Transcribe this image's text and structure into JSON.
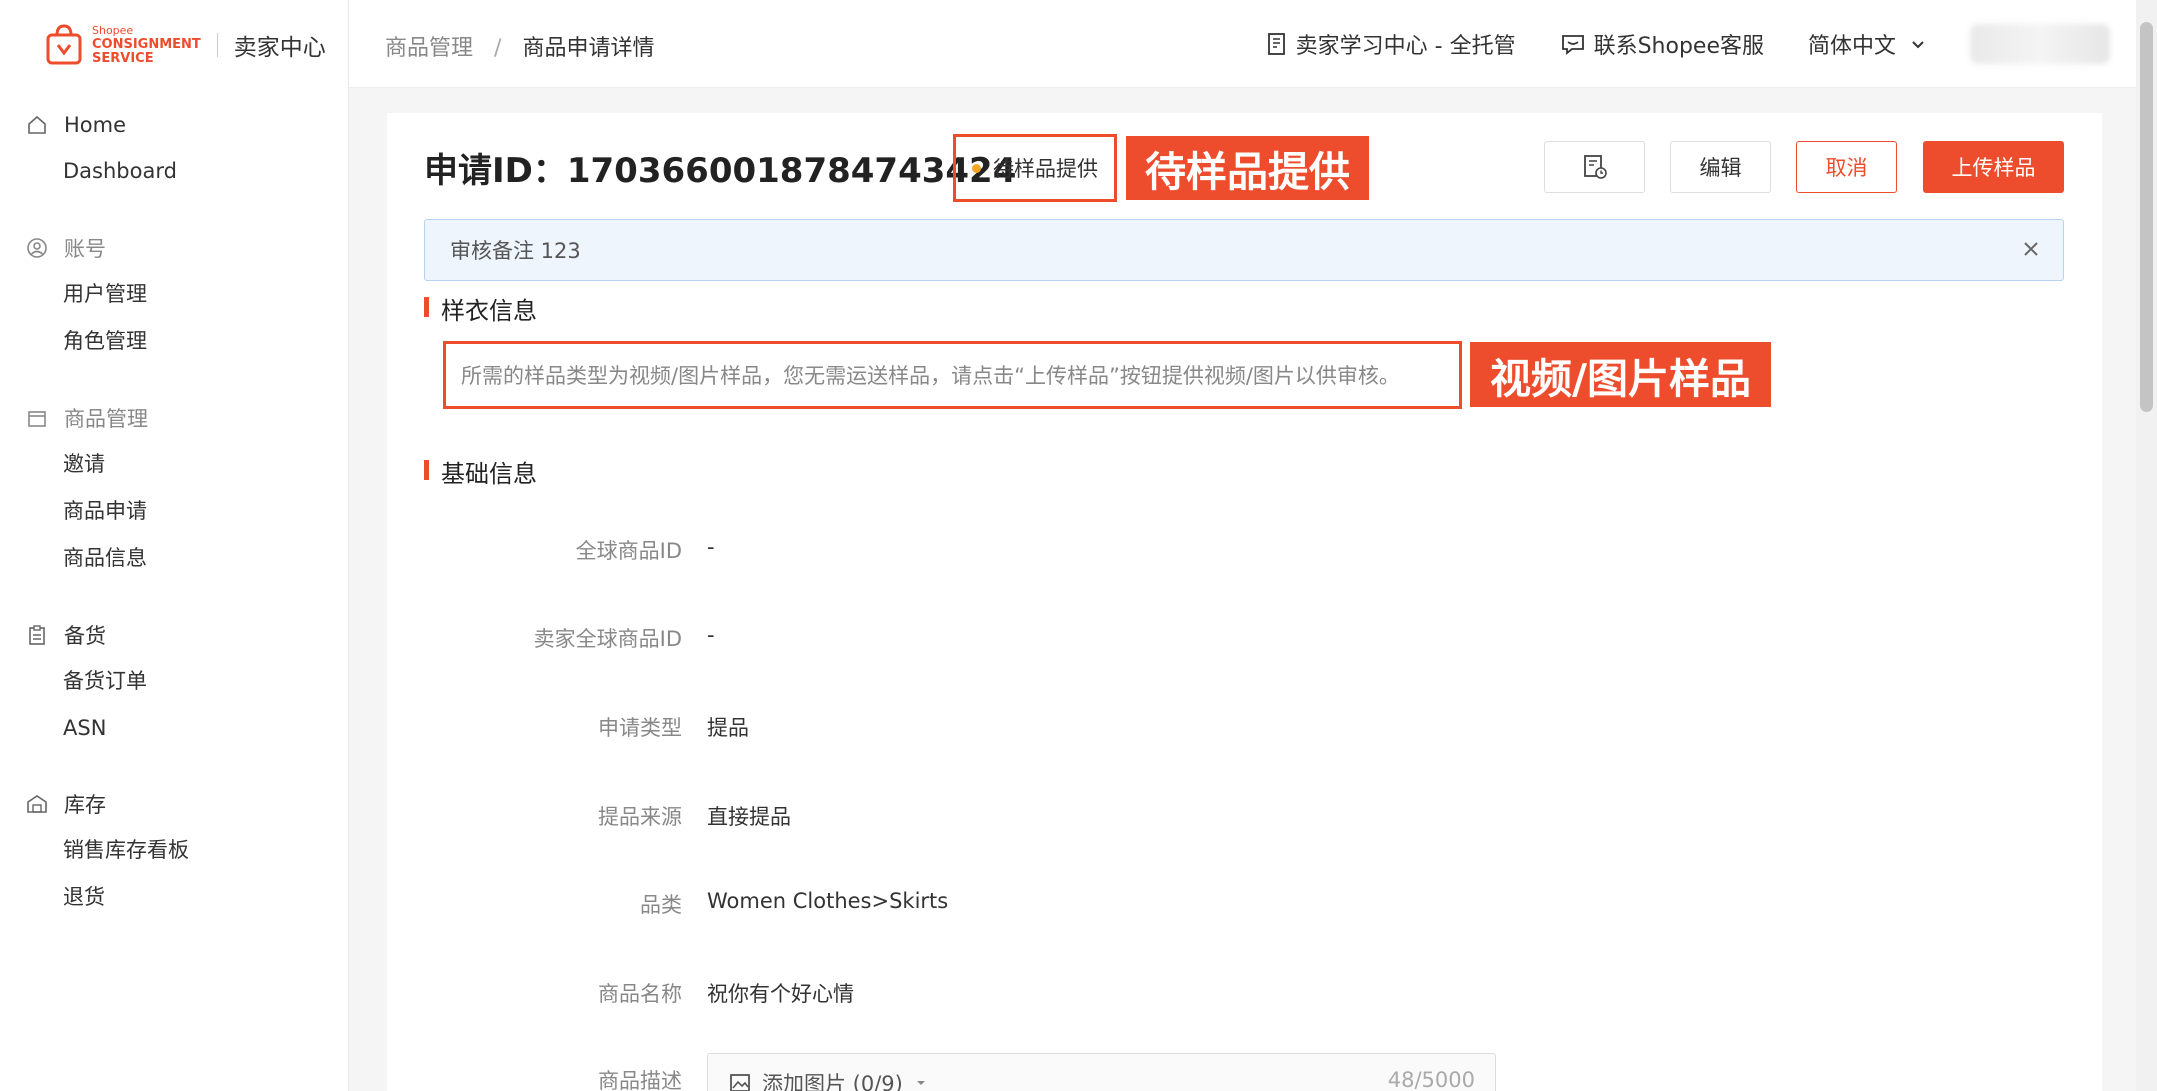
{
  "sidebar": {
    "logo_small": "Shopee",
    "logo_line1": "CONSIGNMENT",
    "logo_line2": "SERVICE",
    "logo_title": "卖家中心",
    "groups": [
      {
        "title": "Home",
        "items": [
          "Dashboard"
        ]
      },
      {
        "title": "账号",
        "items": [
          "用户管理",
          "角色管理"
        ]
      },
      {
        "title": "商品管理",
        "items": [
          "邀请",
          "商品申请",
          "商品信息"
        ]
      },
      {
        "title": "备货",
        "items": [
          "备货订单",
          "ASN"
        ]
      },
      {
        "title": "库存",
        "items": [
          "销售库存看板",
          "退货"
        ]
      }
    ]
  },
  "header": {
    "breadcrumb_parent": "商品管理",
    "breadcrumb_sep": "/",
    "breadcrumb_current": "商品申请详情",
    "learning_center": "卖家学习中心 - 全托管",
    "contact": "联系Shopee客服",
    "language": "简体中文"
  },
  "main": {
    "title": "申请ID：1703660018784743424",
    "status": "待样品提供",
    "annotation_status": "待样品提供",
    "annotation_sample": "视频/图片样品",
    "buttons": {
      "edit": "编辑",
      "cancel": "取消",
      "upload": "上传样品"
    },
    "alert": "审核备注 123",
    "section_sample": "样衣信息",
    "sample_notice": "所需的样品类型为视频/图片样品，您无需运送样品，请点击“上传样品”按钮提供视频/图片以供审核。",
    "section_basic": "基础信息",
    "fields": [
      {
        "label": "全球商品ID",
        "value": "-"
      },
      {
        "label": "卖家全球商品ID",
        "value": "-"
      },
      {
        "label": "申请类型",
        "value": "提品"
      },
      {
        "label": "提品来源",
        "value": "直接提品"
      },
      {
        "label": "品类",
        "value": "Women Clothes>Skirts"
      },
      {
        "label": "商品名称",
        "value": "祝你有个好心情"
      },
      {
        "label": "商品描述",
        "value": ""
      }
    ],
    "desc_add_image": "添加图片 (0/9)",
    "desc_counter": "48/5000"
  }
}
